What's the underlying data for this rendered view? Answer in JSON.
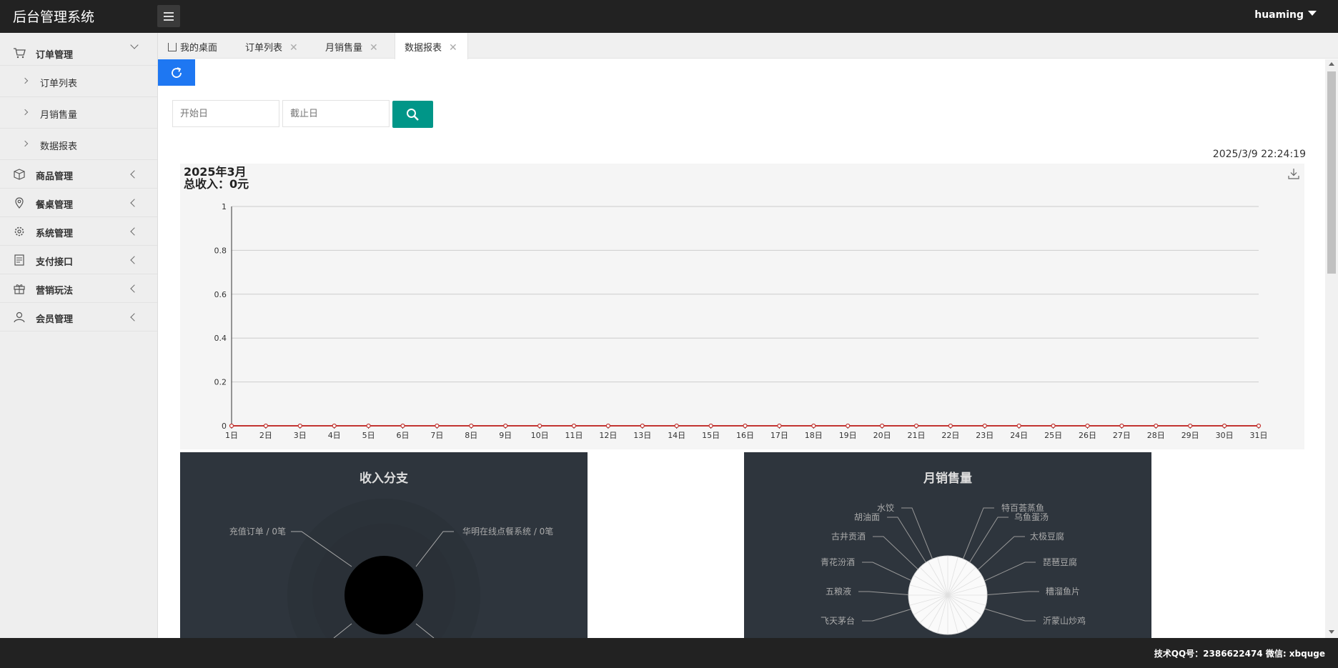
{
  "header": {
    "title": "后台管理系统",
    "username": "huaming"
  },
  "sidebar": {
    "order_group": {
      "label": "订单管理",
      "icon": "cart-icon"
    },
    "order_items": [
      {
        "label": "订单列表"
      },
      {
        "label": "月销售量"
      },
      {
        "label": "数据报表"
      }
    ],
    "groups": [
      {
        "label": "商品管理",
        "icon": "box-icon"
      },
      {
        "label": "餐桌管理",
        "icon": "location-icon"
      },
      {
        "label": "系统管理",
        "icon": "gear-icon"
      },
      {
        "label": "支付接口",
        "icon": "payment-icon"
      },
      {
        "label": "营销玩法",
        "icon": "gift-icon"
      },
      {
        "label": "会员管理",
        "icon": "user-icon"
      }
    ]
  },
  "tabs": [
    {
      "label": "我的桌面",
      "closable": false
    },
    {
      "label": "订单列表",
      "closable": true
    },
    {
      "label": "月销售量",
      "closable": true
    },
    {
      "label": "数据报表",
      "closable": true,
      "active": true
    }
  ],
  "filters": {
    "start_placeholder": "开始日",
    "end_placeholder": "截止日"
  },
  "timestamp": "2025/3/9 22:24:19",
  "colors": {
    "primary": "#1E77F2",
    "search": "#009688",
    "line": "#c23531",
    "dark_panel": "#2e353d"
  },
  "chart_data": [
    {
      "type": "line",
      "title": "2025年3月",
      "subtitle": "总收入：0元",
      "categories": [
        "1日",
        "2日",
        "3日",
        "4日",
        "5日",
        "6日",
        "7日",
        "8日",
        "9日",
        "10日",
        "11日",
        "12日",
        "13日",
        "14日",
        "15日",
        "16日",
        "17日",
        "18日",
        "19日",
        "20日",
        "21日",
        "22日",
        "23日",
        "24日",
        "25日",
        "26日",
        "27日",
        "28日",
        "29日",
        "30日",
        "31日"
      ],
      "values": [
        0,
        0,
        0,
        0,
        0,
        0,
        0,
        0,
        0,
        0,
        0,
        0,
        0,
        0,
        0,
        0,
        0,
        0,
        0,
        0,
        0,
        0,
        0,
        0,
        0,
        0,
        0,
        0,
        0,
        0,
        0
      ],
      "yticks": [
        "0",
        "0.2",
        "0.4",
        "0.6",
        "0.8",
        "1"
      ],
      "ylim": [
        0,
        1
      ],
      "grid": true
    },
    {
      "type": "pie",
      "title": "收入分支",
      "labels": [
        "充值订单 / 0笔",
        "华明在线点餐系统 / 0笔"
      ],
      "values": [
        0,
        0
      ]
    },
    {
      "type": "pie",
      "title": "月销售量",
      "labels": [
        "水饺",
        "胡油面",
        "古井贡酒",
        "青花汾酒",
        "五粮液",
        "飞天茅台",
        "特百荟蒸鱼",
        "乌鱼蛋汤",
        "太极豆腐",
        "琵琶豆腐",
        "糟溜鱼片",
        "沂蒙山炒鸡"
      ],
      "values": [
        0,
        0,
        0,
        0,
        0,
        0,
        0,
        0,
        0,
        0,
        0,
        0
      ]
    }
  ],
  "footer": {
    "text": "技术QQ号：2386622474 微信: xbquge"
  }
}
